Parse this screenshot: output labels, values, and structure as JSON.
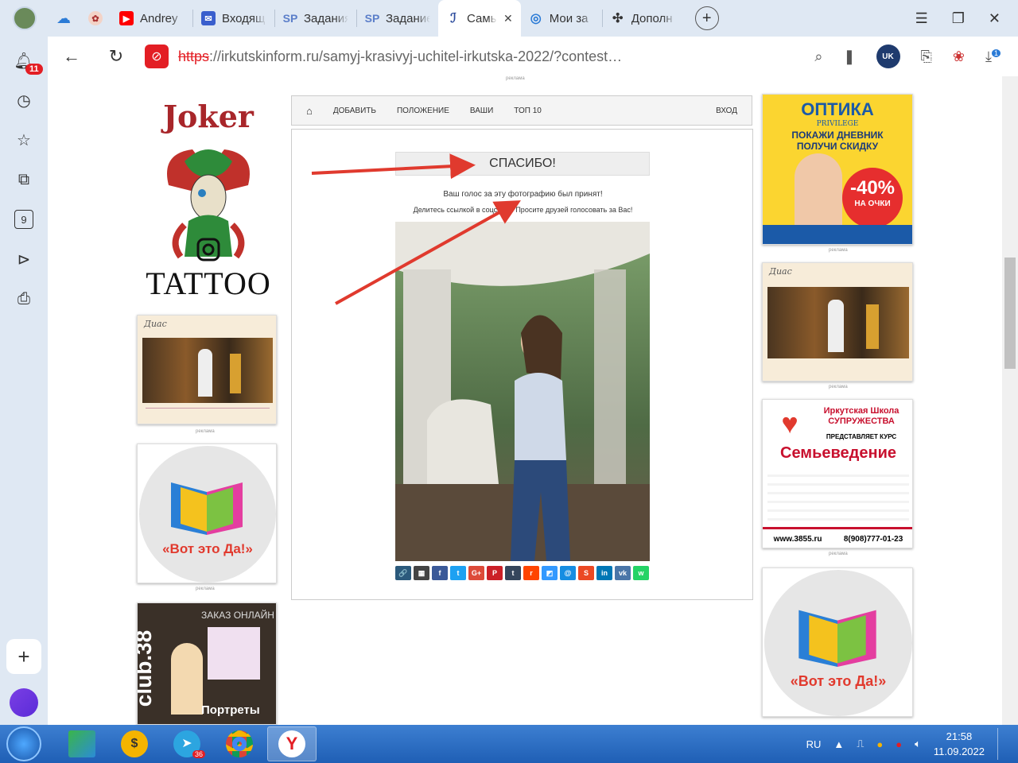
{
  "browser": {
    "tabs": [
      {
        "label": "Andrey",
        "favicon": "youtube-icon",
        "color": "#ff0000"
      },
      {
        "label": "Входящ",
        "favicon": "mail-icon",
        "color": "#3a5fcd"
      },
      {
        "label": "Задания",
        "favicon": "sp-icon",
        "color": "#5b7ec9"
      },
      {
        "label": "Задание",
        "favicon": "sp-icon",
        "color": "#5b7ec9"
      },
      {
        "label": "Самы",
        "favicon": "site-icon",
        "color": "#2a4a9c"
      },
      {
        "label": "Мои за",
        "favicon": "target-icon",
        "color": "#2b7bd6"
      },
      {
        "label": "Дополн",
        "favicon": "puzzle-icon",
        "color": "#333333"
      }
    ],
    "url_scheme": "https",
    "url_rest": "://irkutskinform.ru/samyj-krasivyj-uchitel-irkutska-2022/?contest…",
    "notifications_badge": "11",
    "translate_badge": "UK",
    "downloads_badge": "1"
  },
  "site": {
    "ad_label": "реклама",
    "joker": {
      "title": "Joker",
      "subtitle": "TATTOO"
    },
    "menu": {
      "add": "ДОБАВИТЬ",
      "rules": "ПОЛОЖЕНИЕ",
      "yours": "ВАШИ",
      "top": "ТОП 10",
      "login": "ВХОД"
    },
    "thanks": "СПАСИБО!",
    "vote_accepted": "Ваш голос за эту фотографию был принят!",
    "share_prompt": "Делитесь ссылкой в соцсетях. Просите друзей голосовать за Вас!",
    "ads": {
      "optika_title": "ОПТИКА",
      "optika_brand": "PRIVILEGE",
      "optika_promo": "ПОКАЖИ ДНЕВНИК ПОЛУЧИ СКИДКУ",
      "optika_discount": "-40%",
      "optika_discount_sub": "НА ОЧКИ",
      "school_title": "Иркутская Школа СУПРУЖЕСТВА",
      "school_presents": "ПРЕДСТАВЛЯЕТ КУРС",
      "school_course": "Семьеведение",
      "school_site": "www.3855.ru",
      "school_phone": "8(908)777-01-23",
      "vot_eto_da": "«Вот это Да!»",
      "club": "club.38",
      "club_order": "ЗАКАЗ ОНЛАЙН",
      "club_portraits": "Портреты",
      "dias": "Диас"
    },
    "share_buttons": [
      {
        "name": "link",
        "color": "#2b5a7c",
        "glyph": "🔗"
      },
      {
        "name": "apps",
        "color": "#444",
        "glyph": "▦"
      },
      {
        "name": "facebook",
        "color": "#3b5998",
        "glyph": "f"
      },
      {
        "name": "twitter",
        "color": "#1da1f2",
        "glyph": "t"
      },
      {
        "name": "google",
        "color": "#dd4b39",
        "glyph": "G+"
      },
      {
        "name": "pinterest",
        "color": "#cb2027",
        "glyph": "P"
      },
      {
        "name": "tumblr",
        "color": "#35465c",
        "glyph": "t"
      },
      {
        "name": "reddit",
        "color": "#ff4500",
        "glyph": "r"
      },
      {
        "name": "delicious",
        "color": "#3399ff",
        "glyph": "◩"
      },
      {
        "name": "mail",
        "color": "#168de2",
        "glyph": "@"
      },
      {
        "name": "stumbleupon",
        "color": "#eb4924",
        "glyph": "S"
      },
      {
        "name": "linkedin",
        "color": "#0077b5",
        "glyph": "in"
      },
      {
        "name": "vk",
        "color": "#4a76a8",
        "glyph": "vk"
      },
      {
        "name": "whatsapp",
        "color": "#25d366",
        "glyph": "w"
      }
    ]
  },
  "taskbar": {
    "lang": "RU",
    "time": "21:58",
    "date": "11.09.2022",
    "telegram_badge": "36"
  }
}
